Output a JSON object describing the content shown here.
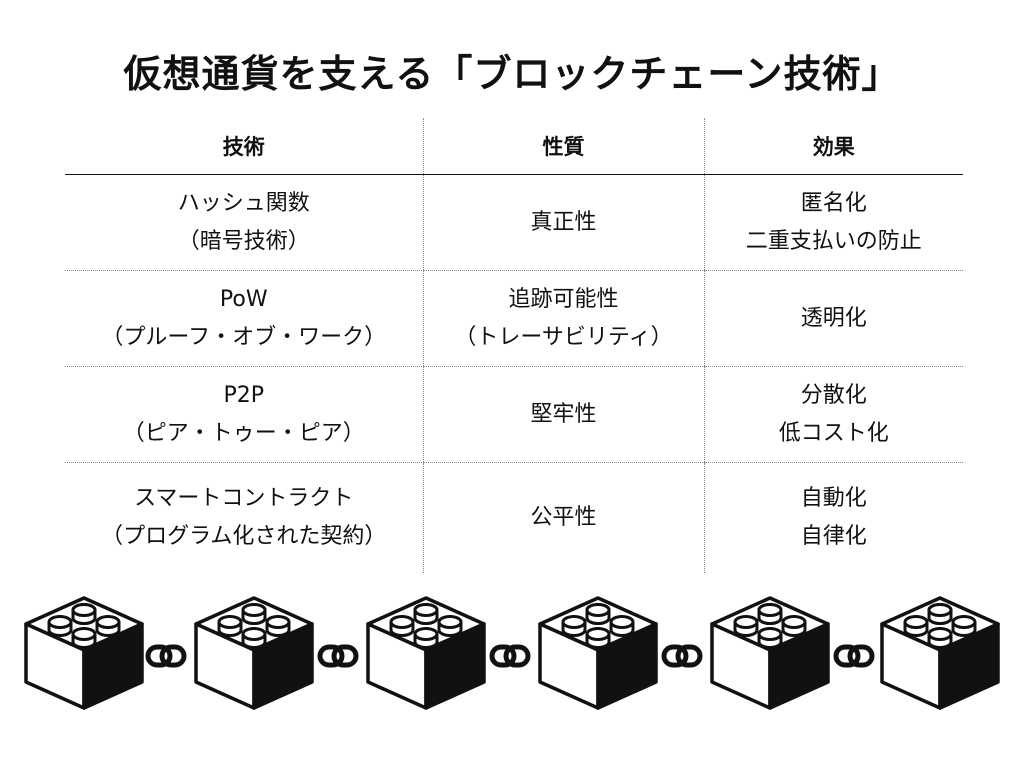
{
  "title": "仮想通貨を支える「ブロックチェーン技術」",
  "table": {
    "headers": [
      "技術",
      "性質",
      "効果"
    ],
    "rows": [
      {
        "tech": [
          "ハッシュ関数",
          "（暗号技術）"
        ],
        "property": [
          "真正性"
        ],
        "effect": [
          "匿名化",
          "二重支払いの防止"
        ]
      },
      {
        "tech": [
          "PoW",
          "（プルーフ・オブ・ワーク）"
        ],
        "property": [
          "追跡可能性",
          "（トレーサビリティ）"
        ],
        "effect": [
          "透明化"
        ]
      },
      {
        "tech": [
          "P2P",
          "（ピア・トゥー・ピア）"
        ],
        "property": [
          "堅牢性"
        ],
        "effect": [
          "分散化",
          "低コスト化"
        ]
      },
      {
        "tech": [
          "スマートコントラクト",
          "（プログラム化された契約）"
        ],
        "property": [
          "公平性"
        ],
        "effect": [
          "自動化",
          "自律化"
        ]
      }
    ]
  },
  "illustration": {
    "icon": "chained-lego-blocks",
    "block_count": 6,
    "colors": {
      "ink": "#111111",
      "paper": "#ffffff"
    }
  }
}
